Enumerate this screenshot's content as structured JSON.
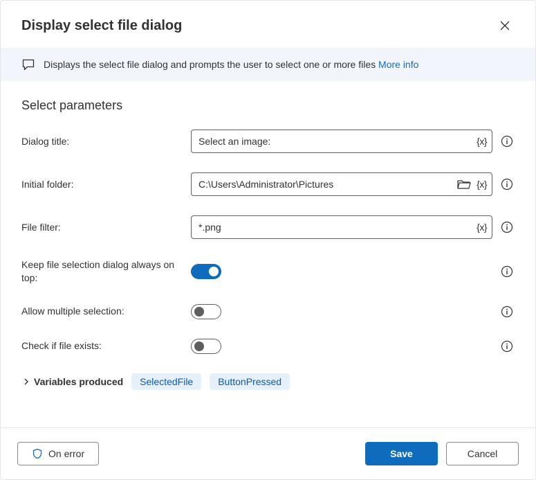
{
  "dialog": {
    "title": "Display select file dialog",
    "description": "Displays the select file dialog and prompts the user to select one or more files",
    "more_info": "More info"
  },
  "section": {
    "title": "Select parameters"
  },
  "params": {
    "dialog_title": {
      "label": "Dialog title:",
      "value": "Select an image:"
    },
    "initial_folder": {
      "label": "Initial folder:",
      "value": "C:\\Users\\Administrator\\Pictures"
    },
    "file_filter": {
      "label": "File filter:",
      "value": "*.png"
    },
    "always_on_top": {
      "label": "Keep file selection dialog always on top:",
      "value": true
    },
    "allow_multiple": {
      "label": "Allow multiple selection:",
      "value": false
    },
    "check_exists": {
      "label": "Check if file exists:",
      "value": false
    }
  },
  "variables": {
    "label": "Variables produced",
    "items": [
      "SelectedFile",
      "ButtonPressed"
    ]
  },
  "footer": {
    "on_error": "On error",
    "save": "Save",
    "cancel": "Cancel"
  },
  "tokens": {
    "var": "{x}"
  }
}
